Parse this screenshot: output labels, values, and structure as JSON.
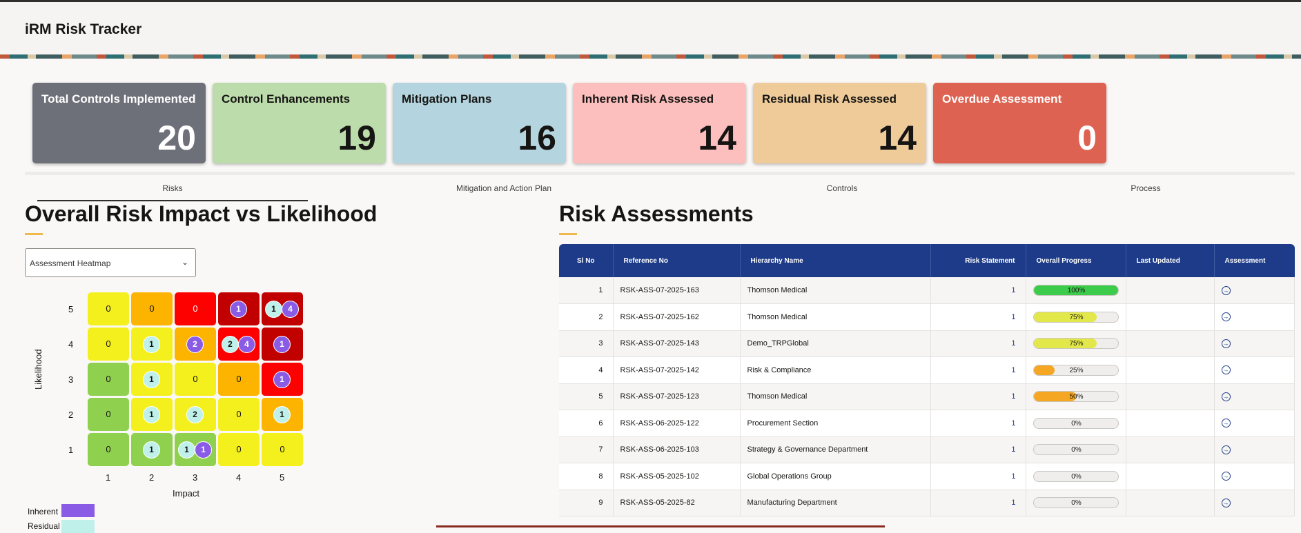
{
  "app": {
    "title": "iRM Risk Tracker"
  },
  "cards": [
    {
      "label": "Total Controls Implemented",
      "value": "20",
      "bg": "#6d7079",
      "fg": "#ffffff"
    },
    {
      "label": "Control Enhancements",
      "value": "19",
      "bg": "#bcdcab",
      "fg": "#161513"
    },
    {
      "label": "Mitigation Plans",
      "value": "16",
      "bg": "#b4d5df",
      "fg": "#161513"
    },
    {
      "label": "Inherent Risk Assessed",
      "value": "14",
      "bg": "#fcbfbd",
      "fg": "#161513"
    },
    {
      "label": "Residual Risk Assessed",
      "value": "14",
      "bg": "#eecb99",
      "fg": "#161513"
    },
    {
      "label": "Overdue Assessment",
      "value": "0",
      "bg": "#de6251",
      "fg": "#ffffff"
    }
  ],
  "tabs": [
    "Risks",
    "Mitigation and Action Plan",
    "Controls",
    "Process"
  ],
  "heatmap": {
    "title": "Overall Risk Impact vs Likelihood",
    "select_value": "Assessment Heatmap",
    "ylabel": "Likelihood",
    "xlabel": "Impact",
    "y_ticks": [
      "5",
      "4",
      "3",
      "2",
      "1"
    ],
    "x_ticks": [
      "1",
      "2",
      "3",
      "4",
      "5"
    ],
    "colors": {
      "yellow": "#f4f01e",
      "orange": "#fcb400",
      "red": "#fd0000",
      "darkred": "#c10000",
      "green": "#8fd14f"
    },
    "rows": [
      [
        {
          "c": "yellow",
          "num": "0"
        },
        {
          "c": "orange",
          "num": "0"
        },
        {
          "c": "red",
          "num": "0",
          "light": true
        },
        {
          "c": "darkred",
          "inh": "1"
        },
        {
          "c": "darkred",
          "res": "1",
          "inh": "4"
        }
      ],
      [
        {
          "c": "yellow",
          "num": "0"
        },
        {
          "c": "yellow",
          "res": "1"
        },
        {
          "c": "orange",
          "inh": "2"
        },
        {
          "c": "red",
          "res": "2",
          "inh": "4"
        },
        {
          "c": "darkred",
          "inh": "1"
        }
      ],
      [
        {
          "c": "green",
          "num": "0"
        },
        {
          "c": "yellow",
          "res": "1"
        },
        {
          "c": "yellow",
          "num": "0"
        },
        {
          "c": "orange",
          "num": "0"
        },
        {
          "c": "red",
          "inh": "1"
        }
      ],
      [
        {
          "c": "green",
          "num": "0"
        },
        {
          "c": "yellow",
          "res": "1"
        },
        {
          "c": "yellow",
          "res": "2"
        },
        {
          "c": "yellow",
          "num": "0"
        },
        {
          "c": "orange",
          "res": "1"
        }
      ],
      [
        {
          "c": "green",
          "num": "0"
        },
        {
          "c": "green",
          "res": "1"
        },
        {
          "c": "green",
          "res": "1",
          "inh": "1"
        },
        {
          "c": "yellow",
          "num": "0"
        },
        {
          "c": "yellow",
          "num": "0"
        }
      ]
    ],
    "legend": [
      {
        "label": "Inherent",
        "color": "#8a5ce6"
      },
      {
        "label": "Residual",
        "color": "#bff0ea"
      }
    ]
  },
  "assessments": {
    "title": "Risk Assessments",
    "columns": [
      "Sl No",
      "Reference No",
      "Hierarchy Name",
      "Risk Statement",
      "Overall Progress",
      "Last Updated",
      "Assessment"
    ],
    "rows": [
      {
        "sl": "1",
        "ref": "RSK-ASS-07-2025-163",
        "hier": "Thomson Medical",
        "rs": "1",
        "progress": 100,
        "label": "100%"
      },
      {
        "sl": "2",
        "ref": "RSK-ASS-07-2025-162",
        "hier": "Thomson Medical",
        "rs": "1",
        "progress": 75,
        "label": "75%"
      },
      {
        "sl": "3",
        "ref": "RSK-ASS-07-2025-143",
        "hier": "Demo_TRPGlobal",
        "rs": "1",
        "progress": 75,
        "label": "75%"
      },
      {
        "sl": "4",
        "ref": "RSK-ASS-07-2025-142",
        "hier": "Risk & Compliance",
        "rs": "1",
        "progress": 25,
        "label": "25%"
      },
      {
        "sl": "5",
        "ref": "RSK-ASS-07-2025-123",
        "hier": "Thomson Medical",
        "rs": "1",
        "progress": 50,
        "label": "50%"
      },
      {
        "sl": "6",
        "ref": "RSK-ASS-06-2025-122",
        "hier": "Procurement Section",
        "rs": "1",
        "progress": 0,
        "label": "0%"
      },
      {
        "sl": "7",
        "ref": "RSK-ASS-06-2025-103",
        "hier": "Strategy & Governance Department",
        "rs": "1",
        "progress": 0,
        "label": "0%"
      },
      {
        "sl": "8",
        "ref": "RSK-ASS-05-2025-102",
        "hier": "Global Operations Group",
        "rs": "1",
        "progress": 0,
        "label": "0%"
      },
      {
        "sl": "9",
        "ref": "RSK-ASS-05-2025-82",
        "hier": "Manufacturing Department",
        "rs": "1",
        "progress": 0,
        "label": "0%"
      }
    ]
  }
}
